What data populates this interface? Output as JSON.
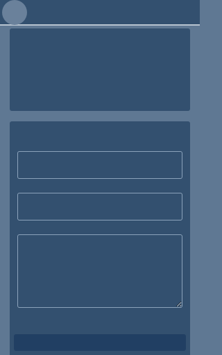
{
  "header": {
    "title": ""
  },
  "form": {
    "field_1": {
      "value": "",
      "placeholder": ""
    },
    "field_2": {
      "value": "",
      "placeholder": ""
    },
    "message": {
      "value": "",
      "placeholder": ""
    },
    "submit_label": ""
  },
  "colors": {
    "background": "#5f7893",
    "panel": "#33506f",
    "header_divider": "#b8c4d0",
    "field_border": "#8ca3bb",
    "button": "#213f63",
    "avatar": "#6a819b"
  }
}
